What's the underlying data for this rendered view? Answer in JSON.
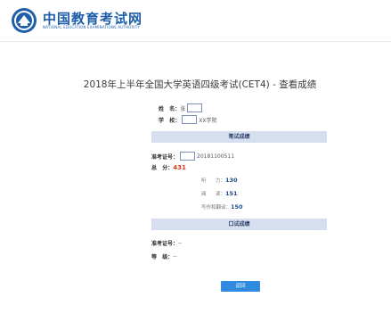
{
  "site": {
    "title": "中国教育考试网",
    "subtitle": "NATIONAL EDUCATION EXAMINATIONS AUTHORITY",
    "emblem": "neea-emblem-icon"
  },
  "page_title": "2018年上半年全国大学英语四级考试(CET4) - 查看成绩",
  "candidate": {
    "name_label": "姓   名：",
    "name_value": "张",
    "school_label": "学   校：",
    "school_value": "XX学院"
  },
  "written": {
    "section_label": "笔试成绩",
    "ticket_label": "准考证号：",
    "ticket_value": "20181100511",
    "total_label": "总   分：",
    "total_value": "431",
    "items": [
      {
        "label": "听      力：",
        "value": "130"
      },
      {
        "label": "阅      读：",
        "value": "151"
      },
      {
        "label": "写作和翻译：",
        "value": "150"
      }
    ]
  },
  "oral": {
    "section_label": "口试成绩",
    "ticket_label": "准考证号：",
    "ticket_value": "--",
    "grade_label": "等   级：",
    "grade_value": "--"
  },
  "back_button": "返回",
  "colors": {
    "brand": "#1f5ea8",
    "band": "#d6dff0",
    "total_score": "#e03a1e",
    "button": "#2f8ae0"
  }
}
